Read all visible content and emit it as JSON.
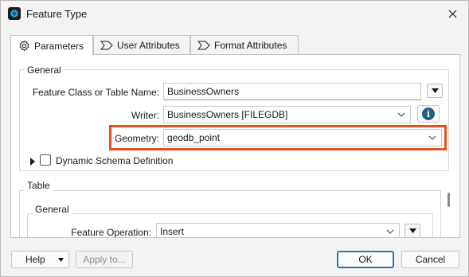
{
  "window": {
    "title": "Feature Type"
  },
  "tabs": [
    {
      "label": "Parameters",
      "icon": "gear-icon",
      "active": true
    },
    {
      "label": "User Attributes",
      "icon": "tag-icon",
      "active": false
    },
    {
      "label": "Format Attributes",
      "icon": "tag-icon",
      "active": false
    }
  ],
  "general": {
    "group_label": "General",
    "feature_class_label": "Feature Class or Table Name:",
    "feature_class_value": "BusinessOwners",
    "writer_label": "Writer:",
    "writer_value": "BusinessOwners [FILEGDB]",
    "geometry_label": "Geometry:",
    "geometry_value": "geodb_point",
    "dynamic_schema_label": "Dynamic Schema Definition",
    "dynamic_schema_checked": false
  },
  "table": {
    "group_label": "Table",
    "sub_group_label": "General",
    "feature_operation_label": "Feature Operation:",
    "feature_operation_value": "Insert"
  },
  "footer": {
    "help_label": "Help",
    "apply_label": "Apply to...",
    "ok_label": "OK",
    "cancel_label": "Cancel"
  },
  "colors": {
    "highlight": "#e8501a",
    "info": "#1f5f8b",
    "default_button": "#2f6fb4"
  }
}
